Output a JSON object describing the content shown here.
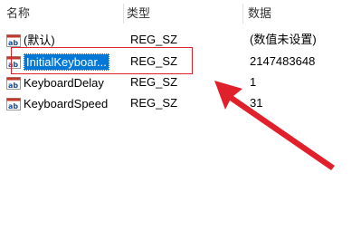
{
  "columns": {
    "name": "名称",
    "type": "类型",
    "data": "数据"
  },
  "rows": [
    {
      "name": "(默认)",
      "type": "REG_SZ",
      "data": "(数值未设置)"
    },
    {
      "name": "InitialKeyboar...",
      "type": "REG_SZ",
      "data": "2147483648"
    },
    {
      "name": "KeyboardDelay",
      "type": "REG_SZ",
      "data": "1"
    },
    {
      "name": "KeyboardSpeed",
      "type": "REG_SZ",
      "data": "31"
    }
  ],
  "icons": {
    "value": "string-value-icon"
  },
  "colors": {
    "selection": "#0078d7",
    "annotation": "#e0202a"
  }
}
